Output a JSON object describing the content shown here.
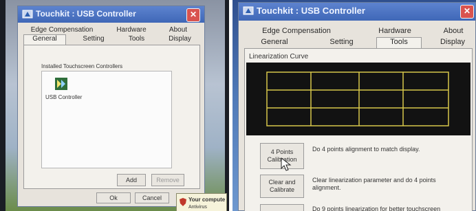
{
  "left_window": {
    "title": "Touchkit : USB Controller",
    "tabs_top": [
      "Edge Compensation",
      "Hardware",
      "About"
    ],
    "tabs_bottom": [
      "General",
      "Setting",
      "Tools",
      "Display"
    ],
    "selected_tab": "General",
    "group_label": "Installed Touchscreen Controllers",
    "device_label": "USB Controller",
    "add_button": "Add",
    "remove_button": "Remove",
    "ok_button": "Ok",
    "cancel_button": "Cancel",
    "popup_text_1": "Your compute",
    "popup_text_2": "Antivirus software m"
  },
  "right_window": {
    "title": "Touchkit : USB Controller",
    "tabs_top": [
      "Edge Compensation",
      "Hardware",
      "About"
    ],
    "tabs_bottom": [
      "General",
      "Setting",
      "Tools",
      "Display"
    ],
    "selected_tab": "Tools",
    "linearization_label": "Linearization Curve",
    "calib4_button": "4 Points Calibration",
    "calib4_desc": "Do 4 points alignment to match display.",
    "clear_button": "Clear and Calibrate",
    "clear_desc": "Clear linearization parameter and do 4 points alignment.",
    "next_desc": "Do 9 points linearization for better touchscreen",
    "grid_color": "#d8c84a"
  }
}
